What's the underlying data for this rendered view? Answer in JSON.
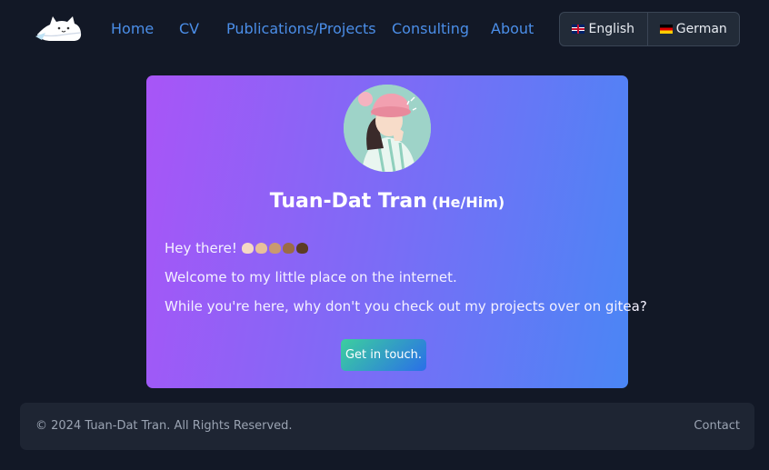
{
  "nav": {
    "links": [
      "Home",
      "CV",
      "Publications/Projects",
      "Consulting",
      "About"
    ]
  },
  "languages": {
    "english": "English",
    "german": "German"
  },
  "card": {
    "name": "Tuan-Dat Tran",
    "pronouns": "(He/Him)",
    "greeting": "Hey there!",
    "line2": "Welcome to my little place on the internet.",
    "line3": "While you're here, why don't you check out my projects over on gitea?",
    "cta": "Get in touch.",
    "wave_colors": [
      "#f5d9c4",
      "#e8c09a",
      "#c99a6e",
      "#9b6b45",
      "#5c3c24"
    ]
  },
  "footer": {
    "copyright": "© 2024 Tuan-Dat Tran. All Rights Reserved.",
    "contact": "Contact"
  },
  "colors": {
    "background": "#121826",
    "nav_link": "#4b8ee8",
    "card_gradient_start": "#a855f7",
    "card_gradient_end": "#4a86f5",
    "footer_bg": "#1e2533"
  }
}
